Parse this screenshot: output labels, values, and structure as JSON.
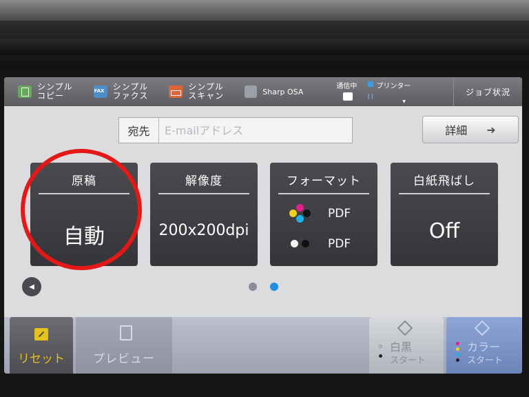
{
  "topbar": {
    "apps": [
      {
        "label": "シンプル\nコピー",
        "icon": "copy-icon"
      },
      {
        "label": "シンプル\nファクス",
        "icon": "fax-icon"
      },
      {
        "label": "シンプル\nスキャン",
        "icon": "scan-icon"
      },
      {
        "label": "Sharp OSA",
        "icon": "osa-icon"
      }
    ],
    "status": {
      "comm": "通信中",
      "printer": "プリンター"
    },
    "job_status": "ジョブ状況"
  },
  "destination": {
    "label": "宛先",
    "placeholder": "E-mailアドレス"
  },
  "detail_button": {
    "label": "詳細"
  },
  "settings": [
    {
      "title": "原稿",
      "value": "自動"
    },
    {
      "title": "解像度",
      "value": "200x200dpi"
    },
    {
      "title": "フォーマット",
      "color_format": "PDF",
      "mono_format": "PDF"
    },
    {
      "title": "白紙飛ばし",
      "value": "Off"
    }
  ],
  "pager": {
    "total": 2,
    "current": 2
  },
  "bottombar": {
    "reset": "リセット",
    "preview": "プレビュー",
    "bw_start": {
      "line1": "白黒",
      "line2": "スタート"
    },
    "color_start": {
      "line1": "カラー",
      "line2": "スタート"
    }
  },
  "colors": {
    "annotation": "#e51818",
    "page_dot_active": "#1e8fe6",
    "page_dot_inactive": "#8c8ca0",
    "reset_accent": "#e6c31c"
  }
}
